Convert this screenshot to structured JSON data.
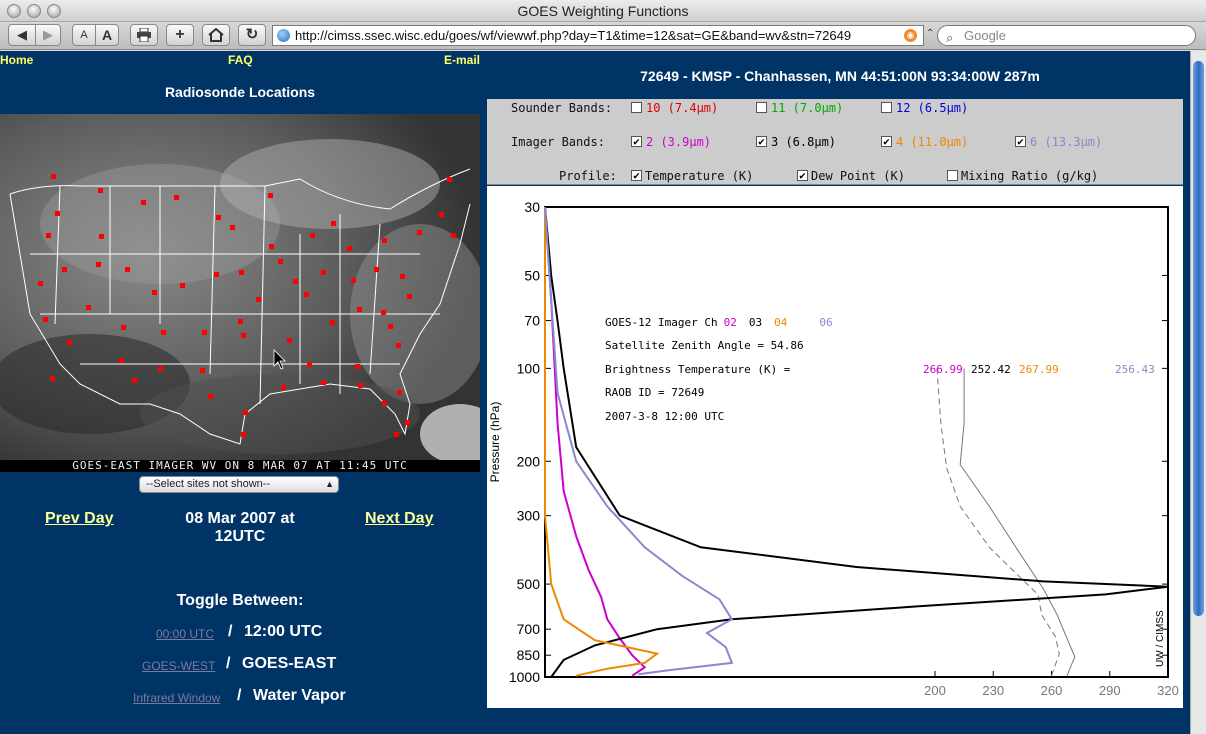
{
  "window": {
    "title": "GOES Weighting Functions"
  },
  "toolbar": {
    "url": "http://cimss.ssec.wisc.edu/goes/wf/viewwf.php?day=T1&time=12&sat=GE&band=wv&stn=72649",
    "search_placeholder": "Google",
    "back_icon": "back-arrow-icon",
    "forward_icon": "forward-arrow-icon",
    "text_smaller": "A",
    "text_larger": "A",
    "add": "+",
    "reload": "↻"
  },
  "nav": {
    "home": "Home",
    "faq": "FAQ",
    "email": "E-mail"
  },
  "left": {
    "title": "Radiosonde Locations",
    "map_caption": "GOES-EAST IMAGER WV ON 8 MAR 07 AT 11:45 UTC",
    "select_label": "--Select sites not shown--",
    "prev_day": "Prev Day",
    "next_day": "Next Day",
    "date_line1": "08 Mar 2007 at",
    "date_line2": "12UTC",
    "toggle_title": "Toggle Between:",
    "toggles": [
      {
        "link": "00:00 UTC",
        "current": "12:00 UTC"
      },
      {
        "link": "GOES-WEST",
        "current": "GOES-EAST"
      },
      {
        "link": "Infrared Window",
        "current": "Water Vapor"
      }
    ],
    "sep": "/"
  },
  "right": {
    "title": "72649 - KMSP - Chanhassen, MN 44:51:00N 93:34:00W 287m",
    "sounder_label": "Sounder Bands:",
    "imager_label": "Imager  Bands:",
    "profile_label": "Profile:",
    "sounder_bands": [
      {
        "label": "10 (7.4µm)",
        "checked": false,
        "color": "#dd0000"
      },
      {
        "label": "11 (7.0µm)",
        "checked": false,
        "color": "#00aa00"
      },
      {
        "label": "12 (6.5µm)",
        "checked": false,
        "color": "#0000dd"
      }
    ],
    "imager_bands": [
      {
        "label": "2 (3.9µm)",
        "checked": true,
        "color": "#cc00cc"
      },
      {
        "label": "3 (6.8µm)",
        "checked": true,
        "color": "#000000"
      },
      {
        "label": "4 (11.0µm)",
        "checked": true,
        "color": "#ee8800"
      },
      {
        "label": "6 (13.3µm)",
        "checked": true,
        "color": "#8888cc"
      }
    ],
    "profiles": [
      {
        "label": "Temperature (K)",
        "checked": true
      },
      {
        "label": "Dew Point (K)",
        "checked": true
      },
      {
        "label": "Mixing Ratio (g/kg)",
        "checked": false
      }
    ],
    "check_mark": "✔"
  },
  "chart_data": {
    "type": "line",
    "ylabel": "Pressure (hPa)",
    "xlabel": "",
    "y_scale": "log",
    "y_ticks": [
      30,
      50,
      70,
      100,
      200,
      300,
      500,
      700,
      850,
      1000
    ],
    "ylim": [
      30,
      1000
    ],
    "x_ticks": [
      200,
      230,
      260,
      290,
      320
    ],
    "xlim_temperature": [
      200,
      320
    ],
    "credit": "UW / CIMSS",
    "annotation": {
      "line1_prefix": "GOES-12 Imager  Ch",
      "channels": [
        {
          "label": "02",
          "color": "#cc00cc"
        },
        {
          "label": "03",
          "color": "#000000"
        },
        {
          "label": "04",
          "color": "#ee8800"
        },
        {
          "label": "06",
          "color": "#8888cc"
        }
      ],
      "zenith": "Satellite Zenith Angle = 54.86",
      "bt_label": "Brightness Temperature (K) =",
      "bt_values": [
        {
          "value": "266.99",
          "color": "#cc00cc"
        },
        {
          "value": "252.42",
          "color": "#000000"
        },
        {
          "value": "267.99",
          "color": "#ee8800"
        },
        {
          "value": "256.43",
          "color": "#8888cc"
        }
      ],
      "raob": "RAOB ID = 72649",
      "datetime": "2007-3-8 12:00 UTC"
    },
    "weighting_functions": [
      {
        "name": "02",
        "color": "#cc00cc",
        "points": [
          [
            0.0,
            30
          ],
          [
            0.01,
            60
          ],
          [
            0.02,
            150
          ],
          [
            0.03,
            250
          ],
          [
            0.05,
            350
          ],
          [
            0.07,
            450
          ],
          [
            0.09,
            550
          ],
          [
            0.1,
            650
          ],
          [
            0.12,
            750
          ],
          [
            0.14,
            850
          ],
          [
            0.16,
            930
          ],
          [
            0.14,
            990
          ]
        ]
      },
      {
        "name": "03",
        "color": "#000000",
        "points": [
          [
            0.0,
            30
          ],
          [
            0.01,
            50
          ],
          [
            0.02,
            70
          ],
          [
            0.03,
            100
          ],
          [
            0.05,
            180
          ],
          [
            0.12,
            300
          ],
          [
            0.25,
            380
          ],
          [
            0.5,
            440
          ],
          [
            0.8,
            490
          ],
          [
            1.0,
            510
          ],
          [
            0.9,
            540
          ],
          [
            0.6,
            590
          ],
          [
            0.3,
            650
          ],
          [
            0.18,
            700
          ],
          [
            0.08,
            790
          ],
          [
            0.03,
            880
          ],
          [
            0.01,
            1000
          ]
        ]
      },
      {
        "name": "04",
        "color": "#ee8800",
        "points": [
          [
            0.0,
            30
          ],
          [
            0.0,
            300
          ],
          [
            0.01,
            500
          ],
          [
            0.03,
            650
          ],
          [
            0.08,
            760
          ],
          [
            0.18,
            840
          ],
          [
            0.16,
            900
          ],
          [
            0.1,
            940
          ],
          [
            0.05,
            990
          ]
        ]
      },
      {
        "name": "06",
        "color": "#8888cc",
        "points": [
          [
            0.0,
            30
          ],
          [
            0.01,
            60
          ],
          [
            0.02,
            120
          ],
          [
            0.05,
            200
          ],
          [
            0.1,
            280
          ],
          [
            0.16,
            380
          ],
          [
            0.22,
            470
          ],
          [
            0.28,
            560
          ],
          [
            0.3,
            650
          ],
          [
            0.26,
            720
          ],
          [
            0.29,
            800
          ],
          [
            0.3,
            900
          ],
          [
            0.2,
            950
          ],
          [
            0.15,
            980
          ]
        ]
      }
    ],
    "temperature": {
      "name": "Temperature (K)",
      "dash": "none",
      "points": [
        [
          215,
          100
        ],
        [
          215,
          150
        ],
        [
          213,
          205
        ],
        [
          228,
          280
        ],
        [
          244,
          400
        ],
        [
          256,
          520
        ],
        [
          263,
          630
        ],
        [
          268,
          750
        ],
        [
          272,
          860
        ],
        [
          268,
          990
        ]
      ]
    },
    "dew_point": {
      "name": "Dew Point (K)",
      "dash": "6,4",
      "points": [
        [
          201,
          100
        ],
        [
          203,
          150
        ],
        [
          206,
          210
        ],
        [
          213,
          280
        ],
        [
          228,
          380
        ],
        [
          243,
          470
        ],
        [
          253,
          540
        ],
        [
          255,
          630
        ],
        [
          262,
          740
        ],
        [
          264,
          840
        ],
        [
          260,
          990
        ]
      ]
    }
  }
}
